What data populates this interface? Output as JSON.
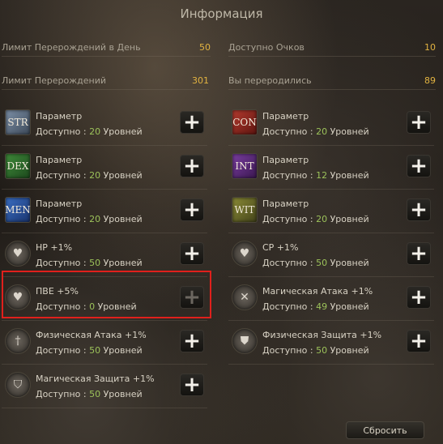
{
  "window": {
    "title": "Информация"
  },
  "stats": {
    "daily_limit": {
      "label": "Лимит Перерождений в День",
      "value": "50"
    },
    "points_available": {
      "label": "Доступно Очков",
      "value": "10"
    },
    "rebirth_limit": {
      "label": "Лимит Перерождений",
      "value": "301"
    },
    "rebirths_done": {
      "label": "Вы переродились",
      "value": "89"
    }
  },
  "left_items": [
    {
      "icon": "STR",
      "name": "Параметр",
      "avail_prefix": "Доступно : ",
      "avail_num": "20",
      "avail_suffix": " Уровней"
    },
    {
      "icon": "DEX",
      "name": "Параметр",
      "avail_prefix": "Доступно : ",
      "avail_num": "20",
      "avail_suffix": " Уровней"
    },
    {
      "icon": "MEN",
      "name": "Параметр",
      "avail_prefix": "Доступно : ",
      "avail_num": "20",
      "avail_suffix": " Уровней"
    },
    {
      "icon": "hp-heart-icon",
      "name": "HP +1%",
      "avail_prefix": "Доступно : ",
      "avail_num": "50",
      "avail_suffix": " Уровней"
    },
    {
      "icon": "pve-heart-icon",
      "name": "ПВЕ +5%",
      "avail_prefix": "Доступно : ",
      "avail_num": "0",
      "avail_suffix": " Уровней"
    },
    {
      "icon": "physical-attack-icon",
      "name": "Физическая Атака +1%",
      "avail_prefix": "Доступно : ",
      "avail_num": "50",
      "avail_suffix": " Уровней"
    },
    {
      "icon": "magic-defense-icon",
      "name": "Магическая Защита +1%",
      "avail_prefix": "Доступно : ",
      "avail_num": "50",
      "avail_suffix": " Уровней"
    }
  ],
  "right_items": [
    {
      "icon": "CON",
      "name": "Параметр",
      "avail_prefix": "Доступно : ",
      "avail_num": "20",
      "avail_suffix": " Уровней"
    },
    {
      "icon": "INT",
      "name": "Параметр",
      "avail_prefix": "Доступно : ",
      "avail_num": "12",
      "avail_suffix": " Уровней"
    },
    {
      "icon": "WIT",
      "name": "Параметр",
      "avail_prefix": "Доступно : ",
      "avail_num": "20",
      "avail_suffix": " Уровней"
    },
    {
      "icon": "cp-heart-icon",
      "name": "CP +1%",
      "avail_prefix": "Доступно : ",
      "avail_num": "50",
      "avail_suffix": " Уровней"
    },
    {
      "icon": "magic-attack-icon",
      "name": "Магическая Атака +1%",
      "avail_prefix": "Доступно : ",
      "avail_num": "49",
      "avail_suffix": " Уровней"
    },
    {
      "icon": "physical-defense-icon",
      "name": "Физическая Защита +1%",
      "avail_prefix": "Доступно : ",
      "avail_num": "50",
      "avail_suffix": " Уровней"
    }
  ],
  "plus_symbol": "+",
  "reset_button": {
    "label": "Сбросить"
  },
  "colors": {
    "value_gold": "#e2b341",
    "level_green": "#9cc25a",
    "highlight_red": "#e0201c"
  }
}
